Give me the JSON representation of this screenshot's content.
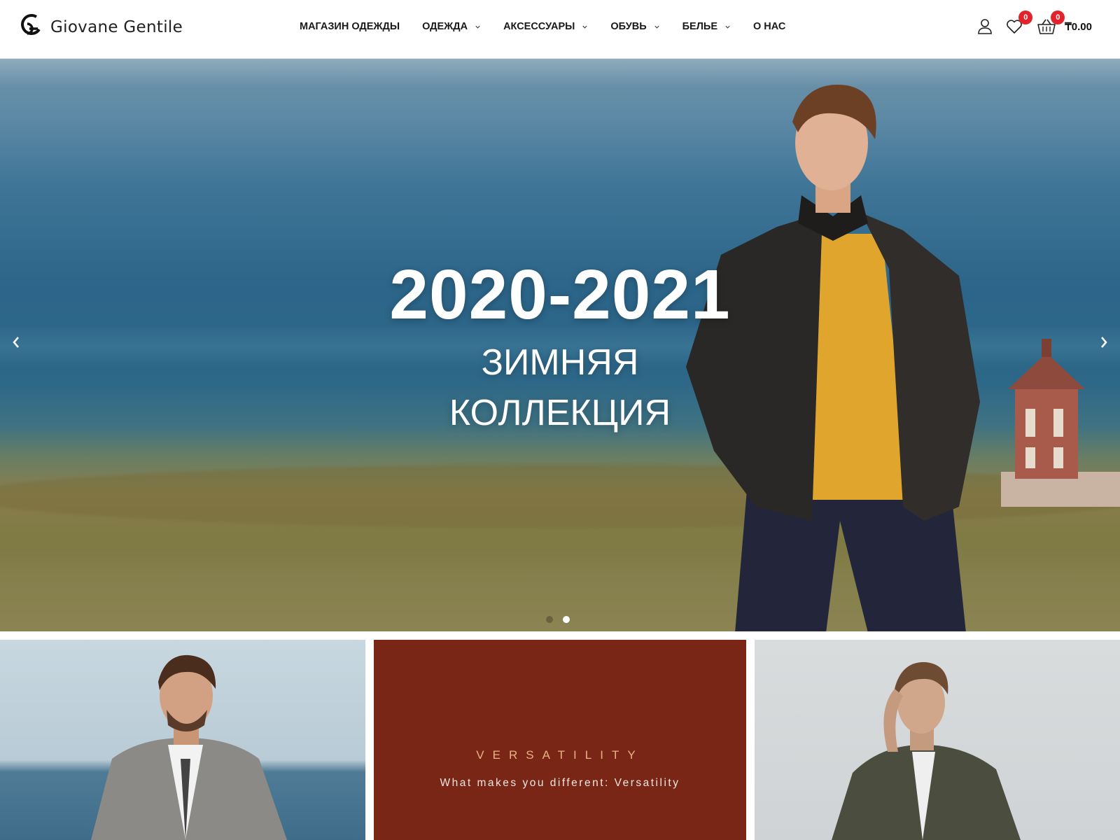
{
  "brand": {
    "name": "Giovane Gentile"
  },
  "nav": {
    "items": [
      {
        "label": "МАГАЗИН ОДЕЖДЫ",
        "has_dropdown": false
      },
      {
        "label": "ОДЕЖДА",
        "has_dropdown": true
      },
      {
        "label": "АКСЕССУАРЫ",
        "has_dropdown": true
      },
      {
        "label": "ОБУВЬ",
        "has_dropdown": true
      },
      {
        "label": "БЕЛЬЕ",
        "has_dropdown": true
      },
      {
        "label": "О НАС",
        "has_dropdown": false
      }
    ]
  },
  "header_icons": {
    "account_icon": "user-icon",
    "wishlist_icon": "heart-icon",
    "wishlist_count": "0",
    "cart_icon": "basket-icon",
    "cart_count": "0",
    "cart_total": "₸0.00"
  },
  "hero": {
    "title": "2020-2021",
    "subtitle_line1": "ЗИМНЯЯ",
    "subtitle_line2": "КОЛЛЕКЦИЯ",
    "slides_total": 2,
    "active_slide": 2
  },
  "promo": {
    "title": "VERSATILITY",
    "subtitle": "What makes you different: Versatility"
  },
  "colors": {
    "badge": "#e3232b",
    "promo_bg": "#7a2617",
    "promo_title": "#e8b184"
  }
}
